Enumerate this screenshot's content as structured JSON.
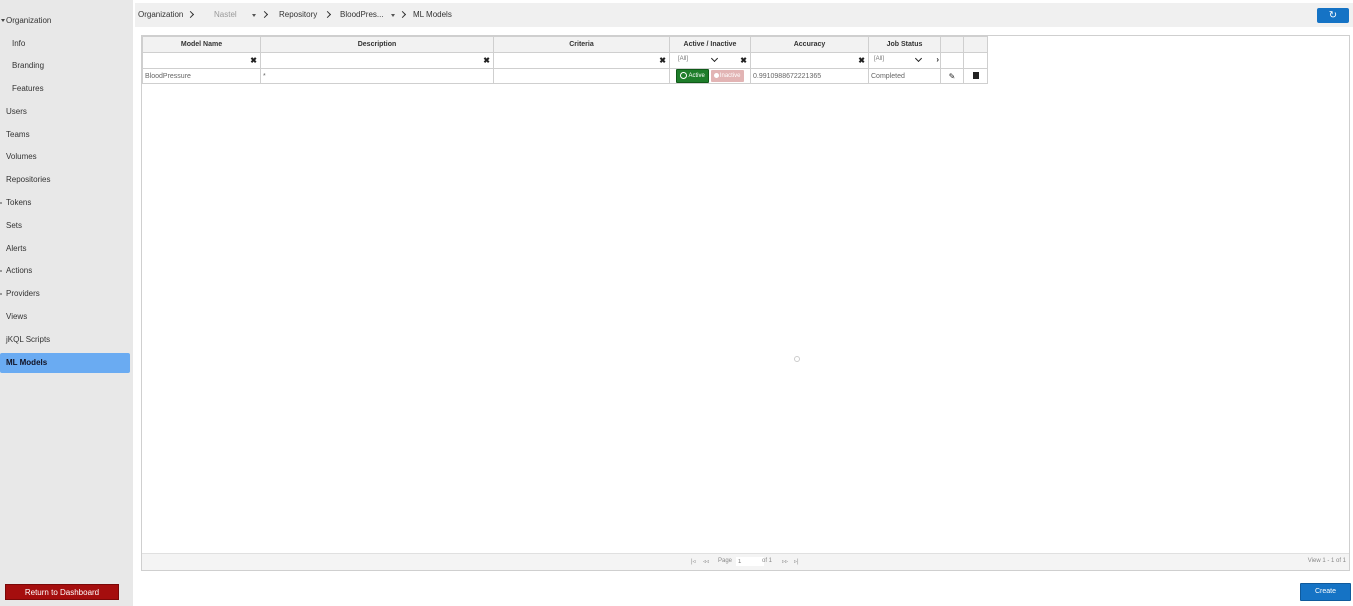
{
  "sidebar": {
    "items": [
      {
        "label": "Organization",
        "level": 0,
        "marker": "expanded"
      },
      {
        "label": "Info",
        "level": 1,
        "marker": ""
      },
      {
        "label": "Branding",
        "level": 1,
        "marker": ""
      },
      {
        "label": "Features",
        "level": 1,
        "marker": ""
      },
      {
        "label": "Users",
        "level": 0,
        "marker": ""
      },
      {
        "label": "Teams",
        "level": 0,
        "marker": ""
      },
      {
        "label": "Volumes",
        "level": 0,
        "marker": ""
      },
      {
        "label": "Repositories",
        "level": 0,
        "marker": ""
      },
      {
        "label": "Tokens",
        "level": 0,
        "marker": "collapsed"
      },
      {
        "label": "Sets",
        "level": 0,
        "marker": ""
      },
      {
        "label": "Alerts",
        "level": 0,
        "marker": ""
      },
      {
        "label": "Actions",
        "level": 0,
        "marker": "collapsed"
      },
      {
        "label": "Providers",
        "level": 0,
        "marker": "collapsed"
      },
      {
        "label": "Views",
        "level": 0,
        "marker": ""
      },
      {
        "label": "jKQL Scripts",
        "level": 0,
        "marker": ""
      },
      {
        "label": "ML Models",
        "level": 0,
        "marker": "",
        "active": true
      }
    ],
    "return_label": "Return to Dashboard"
  },
  "breadcrumb": {
    "organization": "Organization",
    "org_name": "Nastel",
    "repository": "Repository",
    "repo_name": "BloodPres...",
    "current": "ML Models"
  },
  "refresh_icon": "refresh-icon",
  "grid": {
    "columns": [
      "Model Name",
      "Description",
      "Criteria",
      "Active / Inactive",
      "Accuracy",
      "Job Status"
    ],
    "filter_select_all": "[All]",
    "rows": [
      {
        "model_name": "BloodPressure",
        "description": "*",
        "criteria": "",
        "active_label": "Active",
        "inactive_label": "Inactive",
        "accuracy": "0.9910988672221365",
        "job_status": "Completed"
      }
    ],
    "pager": {
      "first": "|◃",
      "prev": "◃◃",
      "page_label": "Page",
      "page_value": "1",
      "of_label": "of 1",
      "next": "▹▹",
      "last": "▹|",
      "view_info": "View 1 - 1 of 1"
    }
  },
  "create_label": "Create",
  "colors": {
    "sidebar_bg": "#e8e8e8",
    "active_item": "#6aabf2",
    "primary": "#1573c5",
    "danger": "#a50e0e",
    "active_badge": "#1e7d2a",
    "inactive_badge": "#e2b4b4"
  }
}
